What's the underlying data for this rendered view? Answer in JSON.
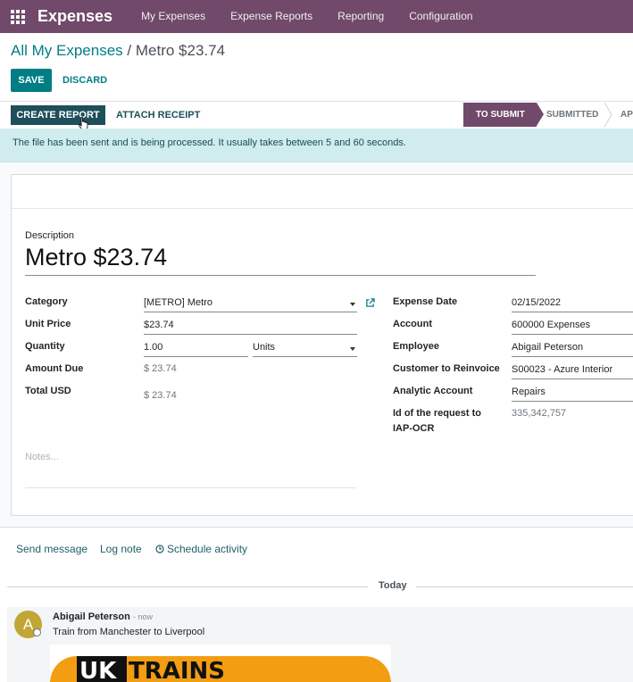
{
  "navbar": {
    "app_name": "Expenses",
    "menu": [
      "My Expenses",
      "Expense Reports",
      "Reporting",
      "Configuration"
    ]
  },
  "breadcrumb": {
    "parent": "All My Expenses",
    "separator": "/",
    "current": "Metro $23.74"
  },
  "buttons": {
    "save": "SAVE",
    "discard": "DISCARD",
    "create_report": "CREATE REPORT",
    "attach_receipt": "ATTACH RECEIPT"
  },
  "statusbar": {
    "stages": [
      "TO SUBMIT",
      "SUBMITTED",
      "AP"
    ],
    "active": "TO SUBMIT"
  },
  "alert": "The file has been sent and is being processed. It usually takes between 5 and 60 seconds.",
  "form": {
    "description_label": "Description",
    "description": "Metro $23.74",
    "left": {
      "category_label": "Category",
      "category": "[METRO] Metro",
      "unit_price_label": "Unit Price",
      "unit_price": "$23.74",
      "quantity_label": "Quantity",
      "quantity": "1.00",
      "uom": "Units",
      "amount_due_label": "Amount Due",
      "amount_due": "$ 23.74",
      "total_label": "Total USD",
      "total": "$ 23.74"
    },
    "right": {
      "expense_date_label": "Expense Date",
      "expense_date": "02/15/2022",
      "account_label": "Account",
      "account": "600000 Expenses",
      "employee_label": "Employee",
      "employee": "Abigail Peterson",
      "customer_label": "Customer to Reinvoice",
      "customer": "S00023 - Azure Interior",
      "analytic_label": "Analytic Account",
      "analytic": "Repairs",
      "ocr_label_line1": "Id of the request to",
      "ocr_label_line2": "IAP-OCR",
      "ocr": "335,342,757"
    },
    "notes_placeholder": "Notes..."
  },
  "chatter": {
    "send_message": "Send message",
    "log_note": "Log note",
    "schedule_activity": "Schedule activity",
    "date_separator": "Today",
    "message": {
      "avatar_initial": "A",
      "author": "Abigail Peterson",
      "time": "- now",
      "body": "Train from Manchester to Liverpool",
      "attachment_logo_text_1": "UK",
      "attachment_logo_text_2": "TRAINS"
    }
  },
  "colors": {
    "navbar": "#71496a",
    "primary": "#017e84",
    "dark_button": "#1f4f5b",
    "alert_bg": "#d0ecee",
    "avatar": "#c2a635",
    "logo_orange": "#f29d12"
  },
  "icons": [
    "apps-grid-icon",
    "external-link-icon",
    "clock-icon",
    "mouse-pointer-icon",
    "dropdown-caret-icon"
  ]
}
